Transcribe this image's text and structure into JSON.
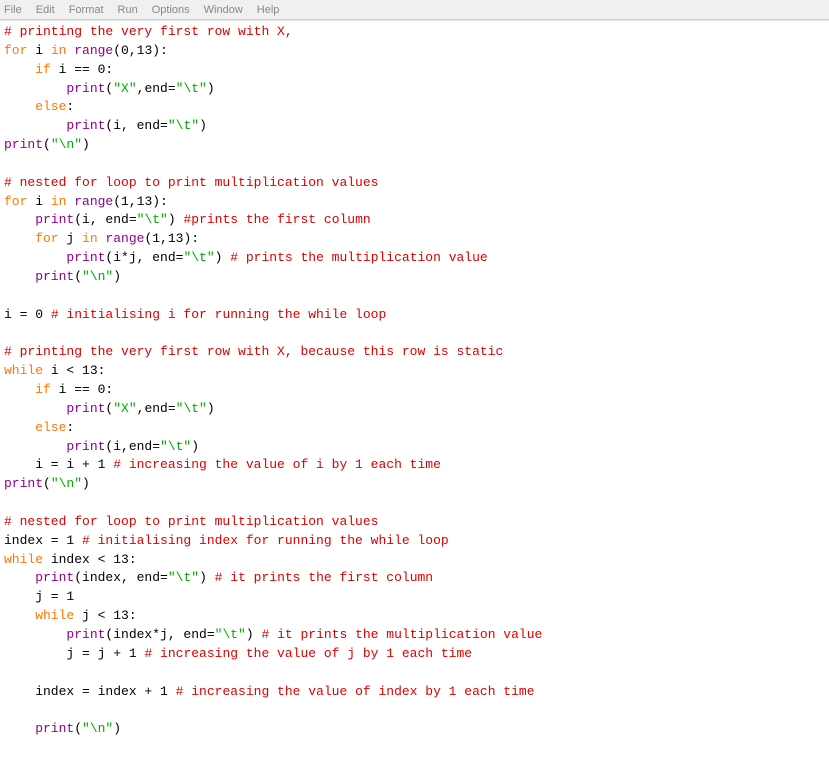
{
  "menu": {
    "file": "File",
    "edit": "Edit",
    "format": "Format",
    "run": "Run",
    "options": "Options",
    "window": "Window",
    "help": "Help"
  },
  "code": {
    "l01_c": "# printing the very first row with X,",
    "l02_kw1": "for",
    "l02_id1": " i ",
    "l02_kw2": "in",
    "l02_fn": " range",
    "l02_rest": "(0,13):",
    "l03_kw": "    if",
    "l03_rest": " i == 0:",
    "l04_fn": "        print",
    "l04_p1": "(",
    "l04_s1": "\"X\"",
    "l04_p2": ",end=",
    "l04_s2": "\"\\t\"",
    "l04_p3": ")",
    "l05_kw": "    else",
    "l05_rest": ":",
    "l06_fn": "        print",
    "l06_p1": "(i, end=",
    "l06_s1": "\"\\t\"",
    "l06_p2": ")",
    "l07_fn": "print",
    "l07_p1": "(",
    "l07_s1": "\"\\n\"",
    "l07_p2": ")",
    "l09_c": "# nested for loop to print multiplication values",
    "l10_kw1": "for",
    "l10_id1": " i ",
    "l10_kw2": "in",
    "l10_fn": " range",
    "l10_rest": "(1,13):",
    "l11_fn": "    print",
    "l11_p1": "(i, end=",
    "l11_s1": "\"\\t\"",
    "l11_p2": ") ",
    "l11_c": "#prints the first column",
    "l12_kw1": "    for",
    "l12_id1": " j ",
    "l12_kw2": "in",
    "l12_fn": " range",
    "l12_rest": "(1,13):",
    "l13_fn": "        print",
    "l13_p1": "(i*j, end=",
    "l13_s1": "\"\\t\"",
    "l13_p2": ") ",
    "l13_c": "# prints the multiplication value",
    "l14_fn": "    print",
    "l14_p1": "(",
    "l14_s1": "\"\\n\"",
    "l14_p2": ")",
    "l16_id": "i = 0 ",
    "l16_c": "# initialising i for running the while loop",
    "l18_c": "# printing the very first row with X, because this row is static",
    "l19_kw": "while",
    "l19_rest": " i < 13:",
    "l20_kw": "    if",
    "l20_rest": " i == 0:",
    "l21_fn": "        print",
    "l21_p1": "(",
    "l21_s1": "\"X\"",
    "l21_p2": ",end=",
    "l21_s2": "\"\\t\"",
    "l21_p3": ")",
    "l22_kw": "    else",
    "l22_rest": ":",
    "l23_fn": "        print",
    "l23_p1": "(i,end=",
    "l23_s1": "\"\\t\"",
    "l23_p2": ")",
    "l24_id": "    i = i + 1 ",
    "l24_c": "# increasing the value of i by 1 each time",
    "l25_fn": "print",
    "l25_p1": "(",
    "l25_s1": "\"\\n\"",
    "l25_p2": ")",
    "l27_c": "# nested for loop to print multiplication values",
    "l28_id": "index = 1 ",
    "l28_c": "# initialising index for running the while loop",
    "l29_kw": "while",
    "l29_rest": " index < 13:",
    "l30_fn": "    print",
    "l30_p1": "(index, end=",
    "l30_s1": "\"\\t\"",
    "l30_p2": ") ",
    "l30_c": "# it prints the first column",
    "l31_id": "    j = 1",
    "l32_kw": "    while",
    "l32_rest": " j < 13:",
    "l33_fn": "        print",
    "l33_p1": "(index*j, end=",
    "l33_s1": "\"\\t\"",
    "l33_p2": ") ",
    "l33_c": "# it prints the multiplication value",
    "l34_id": "        j = j + 1 ",
    "l34_c": "# increasing the value of j by 1 each time",
    "l36_id": "    index = index + 1 ",
    "l36_c": "# increasing the value of index by 1 each time",
    "l38_fn": "    print",
    "l38_p1": "(",
    "l38_s1": "\"\\n\"",
    "l38_p2": ")"
  }
}
